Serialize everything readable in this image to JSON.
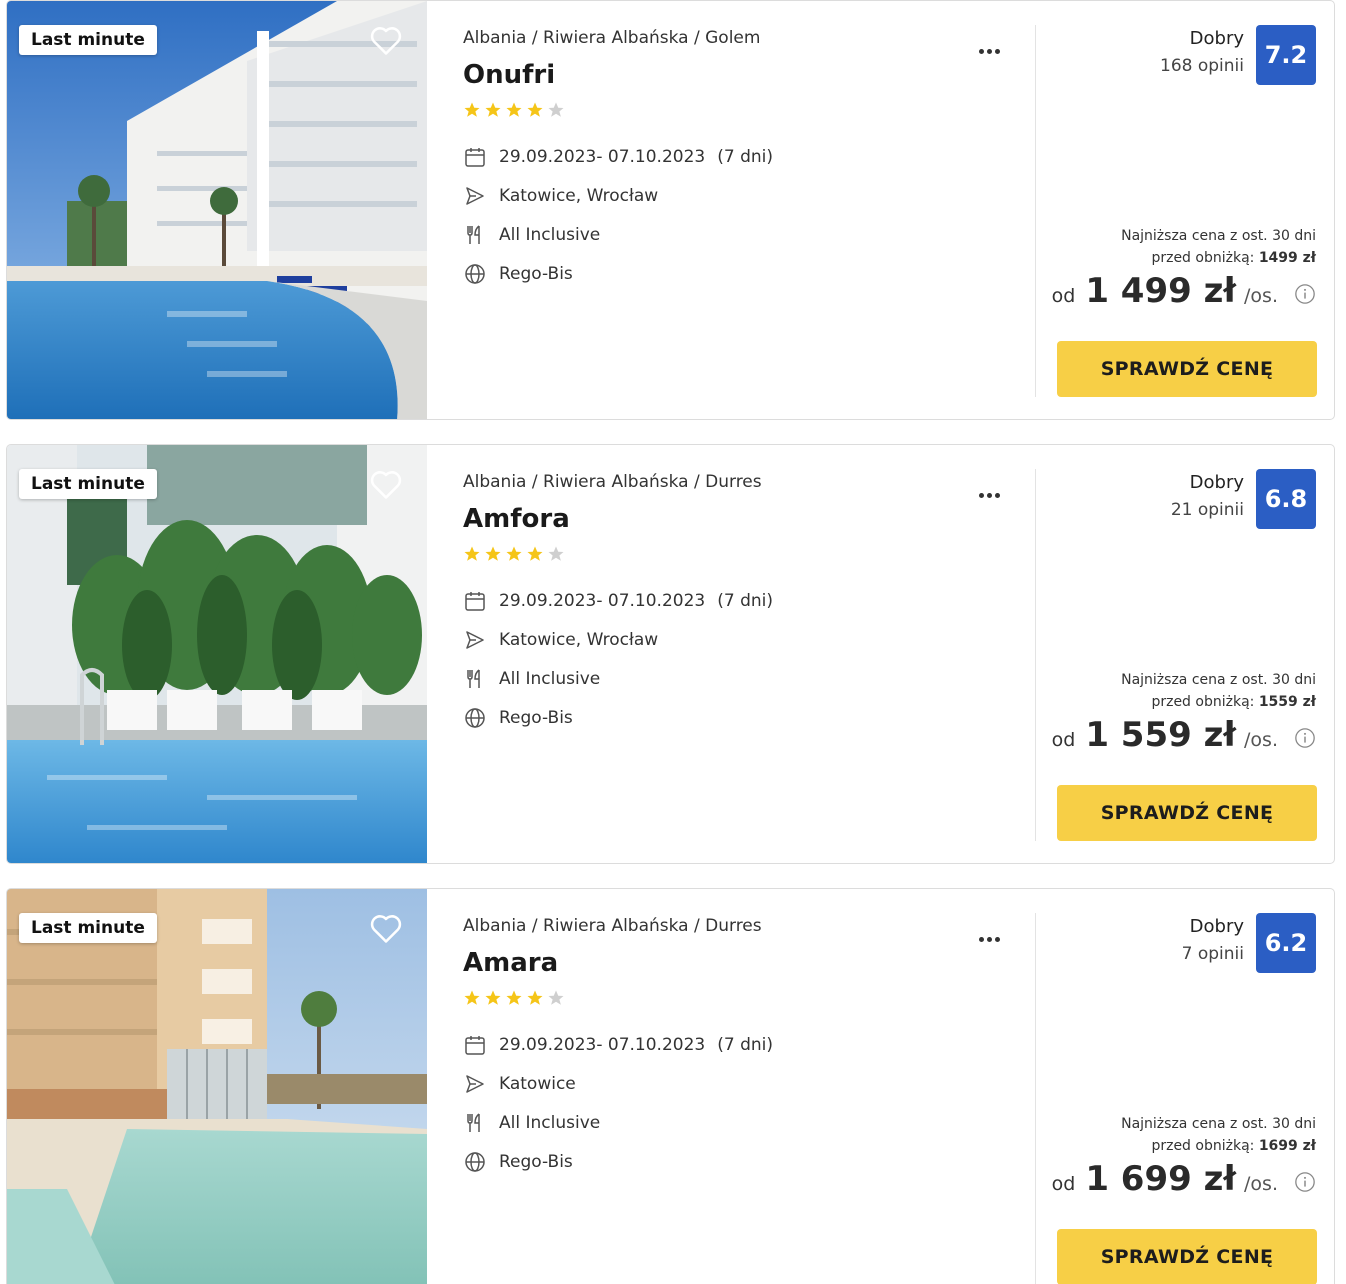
{
  "colors": {
    "cta": "#f7cf46",
    "score": "#2b5ec4",
    "star_on": "#f5c518",
    "star_off": "#cfcfcf"
  },
  "offers": [
    {
      "badge": "Last minute",
      "breadcrumb": "Albania / Riwiera Albańska / Golem",
      "name": "Onufri",
      "stars": 4,
      "dates": "29.09.2023- 07.10.2023",
      "duration": "(7 dni)",
      "departure": "Katowice, Wrocław",
      "board": "All Inclusive",
      "operator": "Rego-Bis",
      "rating_label": "Dobry",
      "reviews": "168 opinii",
      "score": "7.2",
      "lowest_line1": "Najniższa cena z ost. 30 dni",
      "lowest_line2_prefix": "przed obniżką: ",
      "lowest_value": "1499 zł",
      "price_prefix": "od",
      "price": "1 499 zł",
      "price_suffix": "/os.",
      "cta": "SPRAWDŹ CENĘ",
      "photo": "pool-hotel-white"
    },
    {
      "badge": "Last minute",
      "breadcrumb": "Albania / Riwiera Albańska / Durres",
      "name": "Amfora",
      "stars": 4,
      "dates": "29.09.2023- 07.10.2023",
      "duration": "(7 dni)",
      "departure": "Katowice, Wrocław",
      "board": "All Inclusive",
      "operator": "Rego-Bis",
      "rating_label": "Dobry",
      "reviews": "21 opinii",
      "score": "6.8",
      "lowest_line1": "Najniższa cena z ost. 30 dni",
      "lowest_line2_prefix": "przed obniżką: ",
      "lowest_value": "1559 zł",
      "price_prefix": "od",
      "price": "1 559 zł",
      "price_suffix": "/os.",
      "cta": "SPRAWDŹ CENĘ",
      "photo": "pool-plants-loungers"
    },
    {
      "badge": "Last minute",
      "breadcrumb": "Albania / Riwiera Albańska / Durres",
      "name": "Amara",
      "stars": 4,
      "dates": "29.09.2023- 07.10.2023",
      "duration": "(7 dni)",
      "departure": "Katowice",
      "board": "All Inclusive",
      "operator": "Rego-Bis",
      "rating_label": "Dobry",
      "reviews": "7 opinii",
      "score": "6.2",
      "lowest_line1": "Najniższa cena z ost. 30 dni",
      "lowest_line2_prefix": "przed obniżką: ",
      "lowest_value": "1699 zł",
      "price_prefix": "od",
      "price": "1 699 zł",
      "price_suffix": "/os.",
      "cta": "SPRAWDŹ CENĘ",
      "photo": "pool-beige-building"
    }
  ],
  "icons": {
    "favorite": "heart-icon",
    "more": "more-dots-icon",
    "dates": "calendar-icon",
    "departure": "plane-icon",
    "board": "cutlery-icon",
    "operator": "globe-icon",
    "info": "info-icon",
    "star": "star-icon"
  }
}
